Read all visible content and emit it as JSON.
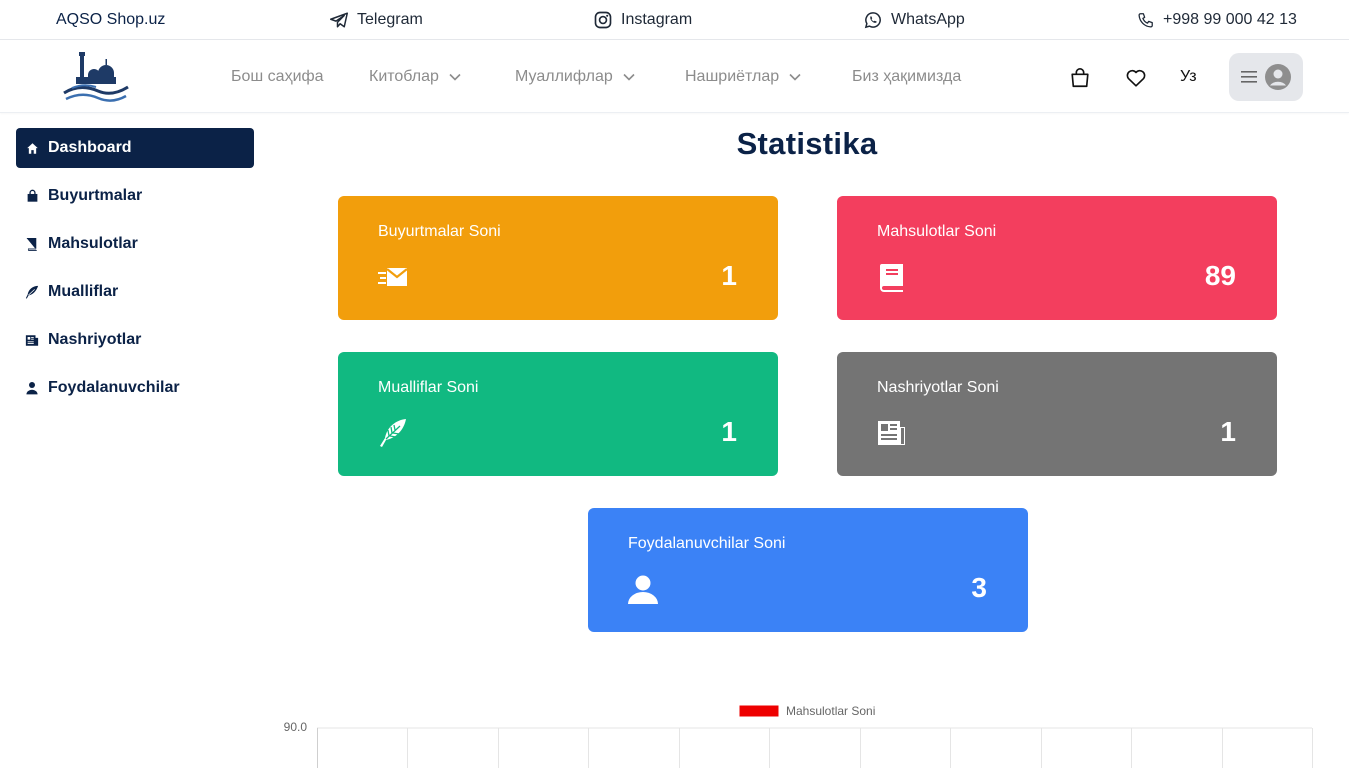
{
  "topbar": {
    "brand": "AQSO Shop.uz",
    "telegram": "Telegram",
    "instagram": "Instagram",
    "whatsapp": "WhatsApp",
    "phone": "+998 99 000 42 13"
  },
  "nav": {
    "home": "Бош саҳифа",
    "books": "Китоблар",
    "authors": "Муаллифлар",
    "publishers": "Нашриётлар",
    "about": "Биз ҳақимизда",
    "lang": "Уз"
  },
  "sidebar": {
    "items": [
      {
        "label": "Dashboard",
        "icon": "home-icon"
      },
      {
        "label": "Buyurtmalar",
        "icon": "bag-icon"
      },
      {
        "label": "Mahsulotlar",
        "icon": "book-icon"
      },
      {
        "label": "Mualliflar",
        "icon": "feather-icon"
      },
      {
        "label": "Nashriyotlar",
        "icon": "newspaper-icon"
      },
      {
        "label": "Foydalanuvchilar",
        "icon": "user-icon"
      }
    ]
  },
  "main": {
    "title": "Statistika",
    "cards": [
      {
        "label": "Buyurtmalar Soni",
        "value": "1",
        "icon": "envelope-fast-icon",
        "color": "#f29e0c"
      },
      {
        "label": "Mahsulotlar Soni",
        "value": "89",
        "icon": "book-icon",
        "color": "#f33e5e"
      },
      {
        "label": "Mualliflar Soni",
        "value": "1",
        "icon": "feather-icon",
        "color": "#11b981"
      },
      {
        "label": "Nashriyotlar Soni",
        "value": "1",
        "icon": "newspaper-icon",
        "color": "#747474"
      },
      {
        "label": "Foydalanuvchilar Soni",
        "value": "3",
        "icon": "user-icon",
        "color": "#3b82f6"
      }
    ]
  },
  "chart_data": {
    "type": "bar",
    "legend": "Mahsulotlar Soni",
    "legend_color": "#ee0000",
    "ymax_label": "90.0",
    "ylim": [
      0,
      90
    ],
    "grid": true,
    "categories_visible": 11
  }
}
